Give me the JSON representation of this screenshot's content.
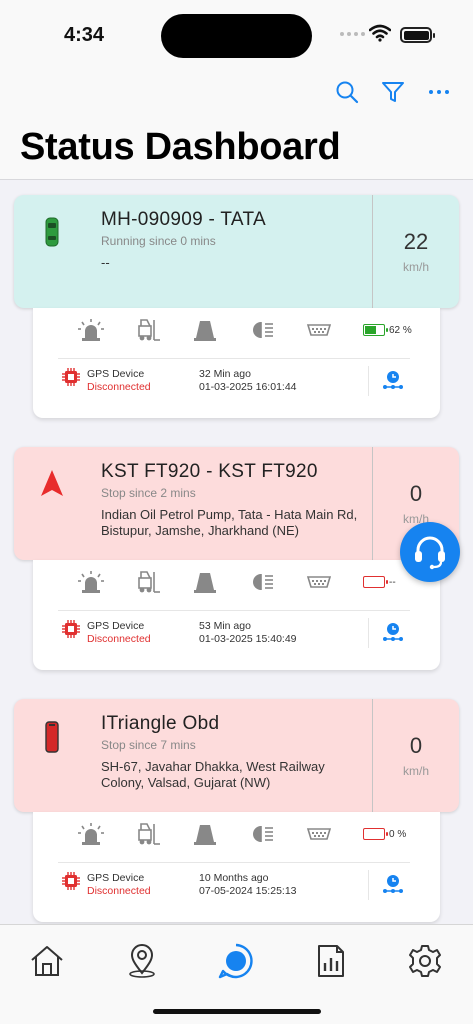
{
  "status_bar": {
    "time": "4:34"
  },
  "header": {
    "title": "Status Dashboard",
    "actions": [
      "search-icon",
      "filter-icon",
      "more-icon"
    ]
  },
  "vehicles": [
    {
      "name": "MH-090909 - TATA",
      "since": "Running since 0 mins",
      "address": "--",
      "speed": "22",
      "unit": "km/h",
      "state": "running",
      "vehicle_icon": "car-top-icon",
      "battery_text": "62 %",
      "battery_level": 0.62,
      "gps_label": "GPS Device",
      "gps_status": "Disconnected",
      "ago": "32 Min ago",
      "timestamp": "01-03-2025 16:01:44"
    },
    {
      "name": "KST FT920 - KST FT920",
      "since": "Stop since 2 mins",
      "address": "Indian Oil Petrol Pump, Tata - Hata Main Rd, Bistupur, Jamshe, Jharkhand (NE)",
      "speed": "0",
      "unit": "km/h",
      "state": "stopped",
      "vehicle_icon": "navigation-arrow-icon",
      "battery_text": "--",
      "battery_level": 0,
      "gps_label": "GPS Device",
      "gps_status": "Disconnected",
      "ago": "53 Min ago",
      "timestamp": "01-03-2025 15:40:49"
    },
    {
      "name": "ITriangle Obd",
      "since": "Stop since 7 mins",
      "address": "SH-67, Javahar Dhakka, West Railway Colony, Valsad, Gujarat (NW)",
      "speed": "0",
      "unit": "km/h",
      "state": "stopped",
      "vehicle_icon": "device-icon",
      "battery_text": "0 %",
      "battery_level": 0,
      "gps_label": "GPS Device",
      "gps_status": "Disconnected",
      "ago": "10 Months ago",
      "timestamp": "07-05-2024 15:25:13"
    }
  ],
  "colors": {
    "accent": "#1683f0",
    "running_bg": "#d4f1ef",
    "stopped_bg": "#fddcdc",
    "disconnected": "#e03030",
    "battery_ok": "#2aa52a"
  },
  "tabs": [
    "home-icon",
    "map-pin-icon",
    "status-icon",
    "reports-icon",
    "settings-icon"
  ],
  "active_tab": "status-icon"
}
